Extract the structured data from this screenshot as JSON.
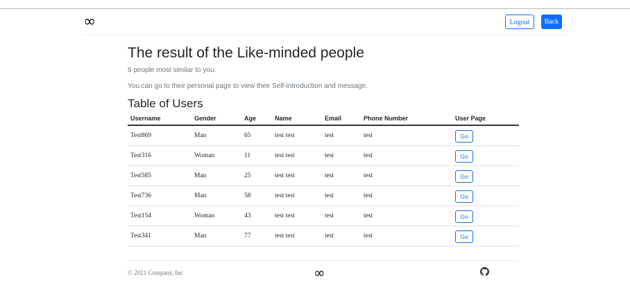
{
  "header": {
    "logo_glyph": "∞",
    "logout_label": "Logout",
    "back_label": "Back"
  },
  "main": {
    "title": "The result of the Like-minded people",
    "subtitle": "6 people most similar to you.",
    "description": "You can go to their personal page to view their Self-introduction and message.",
    "table_title": "Table of Users"
  },
  "table": {
    "columns": [
      "Username",
      "Gender",
      "Age",
      "Name",
      "Email",
      "Phone Number",
      "User Page"
    ],
    "rows": [
      {
        "username": "Test869",
        "gender": "Man",
        "age": "65",
        "name": "test test",
        "email": "test",
        "phone": "test",
        "action": "Go"
      },
      {
        "username": "Test316",
        "gender": "Woman",
        "age": "11",
        "name": "test test",
        "email": "test",
        "phone": "test",
        "action": "Go"
      },
      {
        "username": "Test585",
        "gender": "Man",
        "age": "25",
        "name": "test test",
        "email": "test",
        "phone": "test",
        "action": "Go"
      },
      {
        "username": "Test736",
        "gender": "Man",
        "age": "58",
        "name": "test test",
        "email": "test",
        "phone": "test",
        "action": "Go"
      },
      {
        "username": "Test154",
        "gender": "Woman",
        "age": "43",
        "name": "test test",
        "email": "test",
        "phone": "test",
        "action": "Go"
      },
      {
        "username": "Test341",
        "gender": "Man",
        "age": "77",
        "name": "test test",
        "email": "test",
        "phone": "test",
        "action": "Go"
      }
    ]
  },
  "footer": {
    "copyright": "© 2021 Company, Inc",
    "logo_glyph": "∞",
    "github_icon": "github-icon"
  },
  "colors": {
    "primary": "#0d6efd",
    "text": "#212529",
    "muted": "#6c757d"
  }
}
